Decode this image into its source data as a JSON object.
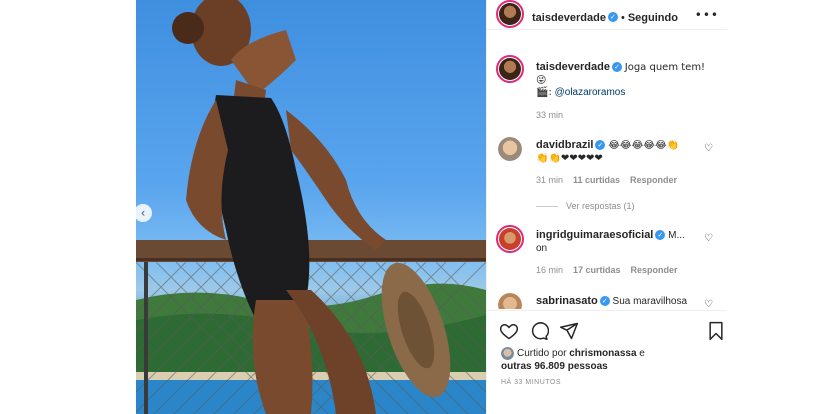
{
  "post": {
    "author": "taisdeverdade",
    "follow_status": "Seguindo",
    "dot": "•"
  },
  "caption": {
    "author": "taisdeverdade",
    "text": "Joga quem tem! 😜",
    "credit_icon": "🎬:",
    "credit_mention": "@olazaroramos",
    "time": "33 min"
  },
  "comments": [
    {
      "author": "davidbrazil",
      "text_line1": "😂😂😂😂😂👏",
      "text_line2": "👏👏❤❤❤❤❤",
      "time": "31 min",
      "likes": "11 curtidas",
      "reply": "Responder",
      "view_replies": "Ver respostas (1)"
    },
    {
      "author": "ingridguimaraesoficial",
      "text_line1": "M...",
      "text_line2": "on",
      "time": "16 min",
      "likes": "17 curtidas",
      "reply": "Responder"
    },
    {
      "author": "sabrinasato",
      "text_line1": "Sua maravilhosa"
    }
  ],
  "likes": {
    "prefix": "Curtido por",
    "user": "chrismonassa",
    "suffix": "e",
    "others": "outras 96.809 pessoas"
  },
  "timestamp": "HÁ 33 MINUTOS",
  "icons": {
    "more": "more-options-icon",
    "heart": "heart-icon",
    "comment": "comment-icon",
    "share": "share-icon",
    "save": "bookmark-icon",
    "verified": "verified-badge-icon",
    "prev": "chevron-left-icon"
  },
  "colors": {
    "verified": "#3897f0",
    "story_ring": "#dd2a7b",
    "mention": "#00376b",
    "muted": "#8e8e8e"
  }
}
